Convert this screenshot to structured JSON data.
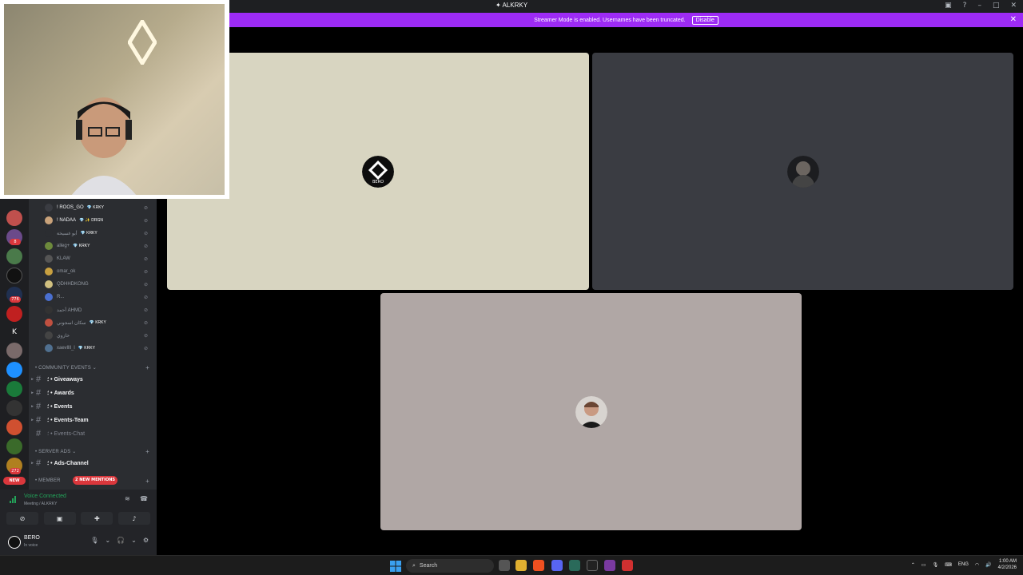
{
  "window": {
    "title": "ALKRKY"
  },
  "banner": {
    "message": "Streamer Mode is enabled. Usernames have been truncated.",
    "disable_label": "Disable",
    "color": "#9d2bf5"
  },
  "members": [
    {
      "name": "! ROOS_GO",
      "tag": "💎 KRKY",
      "color": "#3a3c42"
    },
    {
      "name": "! NADAA",
      "tag": "💎 ✨ DRGN",
      "color": "#c9a27a"
    },
    {
      "name": "أبو غسيخة",
      "tag": "💎 KRKY",
      "color": "#2b2d31"
    },
    {
      "name": "alleg+",
      "tag": "💎 KRKY",
      "color": "#6d8a3c"
    },
    {
      "name": "KLAW",
      "tag": "",
      "color": "#555"
    },
    {
      "name": "omar_ok",
      "tag": "",
      "color": "#c8a040"
    },
    {
      "name": "QDHHDKONG",
      "tag": "",
      "color": "#d0c080"
    },
    {
      "name": "R...",
      "tag": "",
      "color": "#4a6fd0"
    },
    {
      "name": "أحمد AHMD",
      "tag": "",
      "color": "#333"
    },
    {
      "name": "سكان اسجوني",
      "tag": "💎 KRKY",
      "color": "#c05040"
    },
    {
      "name": "خازوي",
      "tag": "",
      "color": "#444"
    },
    {
      "name": "xaevllll_l",
      "tag": "💎 KRKY",
      "color": "#507090"
    }
  ],
  "categories": {
    "community_events": "• COMMUNITY EVENTS ⌄",
    "server_ads": "• SERVER ADS ⌄",
    "members": "• MEMBER"
  },
  "channels": {
    "giveaways": "؛ • Giveaways",
    "awards": "؛ • Awards",
    "events": "؛ • Events",
    "events_team": "؛ • Events-Team",
    "events_chat": "؛ • Events-Chat",
    "ads_channel": "؛ • Ads-Channel"
  },
  "mentions_pill": "2 NEW MENTIONS",
  "server_badges": {
    "b1": "8",
    "b2": "776",
    "b3": "272",
    "new": "NEW",
    "k": "K"
  },
  "voice": {
    "title": "Voice Connected",
    "sub": "Meeting / ALKRKY"
  },
  "user": {
    "name": "BERO",
    "status": "In voice"
  },
  "tile1": {
    "avatar_label": "BERO"
  },
  "taskbar": {
    "search_label": "Search",
    "lang": "ENG",
    "time": "1:00 AM",
    "date": "4/2/2026"
  }
}
